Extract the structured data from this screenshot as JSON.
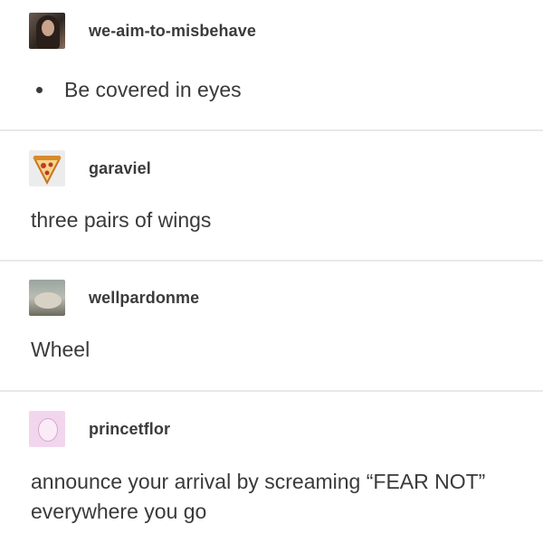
{
  "posts": [
    {
      "username": "we-aim-to-misbehave",
      "avatar_icon": "user-avatar-woman-icon",
      "bullet_text": "Be covered in eyes"
    },
    {
      "username": "garaviel",
      "avatar_icon": "pizza-slice-icon",
      "text": "three pairs of wings"
    },
    {
      "username": "wellpardonme",
      "avatar_icon": "user-avatar-photo-icon",
      "text": "Wheel"
    },
    {
      "username": "princetflor",
      "avatar_icon": "user-avatar-pink-drawing-icon",
      "text_lines": [
        "announce your arrival by screaming “FEAR NOT”",
        "everywhere you go"
      ]
    }
  ],
  "colors": {
    "text": "#3a3a3a",
    "divider": "#e9e9e9",
    "pizza_crust": "#d98a2b",
    "pizza_cheese": "#f6d48a"
  }
}
